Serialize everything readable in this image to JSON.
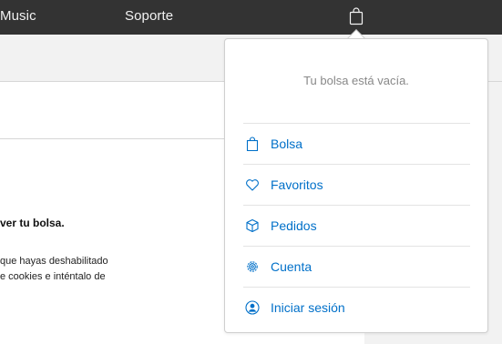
{
  "nav": {
    "items": [
      "Music",
      "Soporte"
    ],
    "bag_icon": "bag-icon"
  },
  "page": {
    "bold_text": "ver tu bolsa.",
    "lines": [
      "que hayas deshabilitado",
      "e cookies e inténtalo de"
    ]
  },
  "bag_menu": {
    "empty_message": "Tu bolsa está vacía.",
    "items": [
      {
        "label": "Bolsa",
        "icon": "bag-icon"
      },
      {
        "label": "Favoritos",
        "icon": "heart-icon"
      },
      {
        "label": "Pedidos",
        "icon": "box-icon"
      },
      {
        "label": "Cuenta",
        "icon": "gear-icon"
      },
      {
        "label": "Iniciar sesión",
        "icon": "user-icon"
      }
    ]
  },
  "colors": {
    "nav_bg": "#333333",
    "link": "#0070c9",
    "muted_text": "#888888"
  }
}
